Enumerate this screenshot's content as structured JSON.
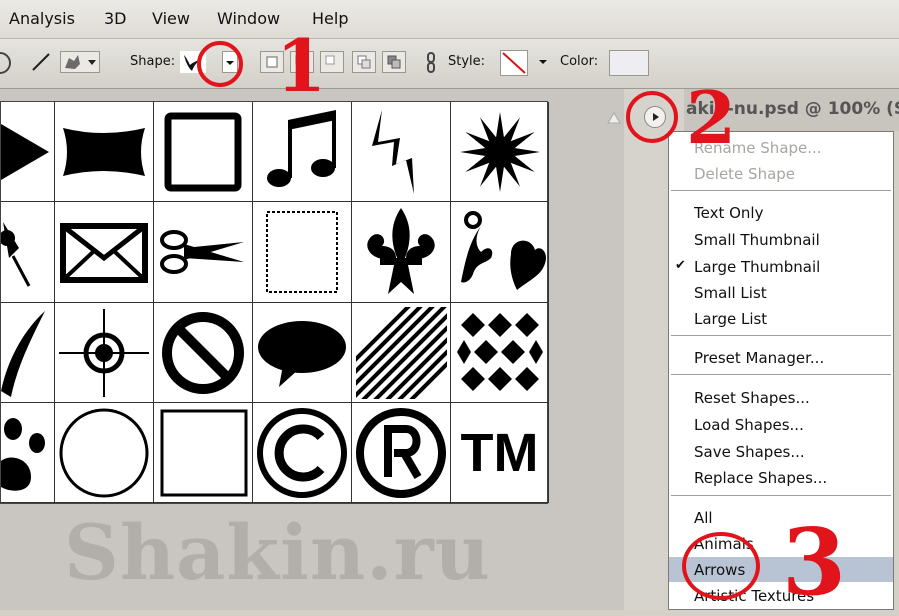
{
  "menubar": {
    "items": [
      "Analysis",
      "3D",
      "View",
      "Window",
      "Help"
    ]
  },
  "options": {
    "shape_label": "Shape:",
    "style_label": "Style:",
    "color_label": "Color:"
  },
  "document": {
    "title": "akin-nu.psd @ 100% (S"
  },
  "shape_icons": [
    "arrow-right-icon",
    "banner-icon",
    "frame-icon",
    "music-note-icon",
    "lightning-icon",
    "starburst-icon",
    "pushpin-icon",
    "envelope-icon",
    "scissors-icon",
    "stamp-frame-icon",
    "fleur-de-lis-icon",
    "ornament-heart-icon",
    "brush-stroke-icon",
    "target-crosshair-icon",
    "no-sign-icon",
    "speech-bubble-icon",
    "hatched-square-icon",
    "checkerboard-icon",
    "paw-print-icon",
    "circle-frame-icon",
    "square-frame-icon",
    "copyright-icon",
    "registered-icon",
    "trademark-icon"
  ],
  "trademark_text": "TM",
  "flyout_menu": {
    "rename": "Rename Shape...",
    "delete": "Delete Shape",
    "text_only": "Text Only",
    "small_thumb": "Small Thumbnail",
    "check_mark": "✔",
    "large_thumb": "Large Thumbnail",
    "small_list": "Small List",
    "large_list": "Large List",
    "preset_manager": "Preset Manager...",
    "reset": "Reset Shapes...",
    "load": "Load Shapes...",
    "save": "Save Shapes...",
    "replace": "Replace Shapes...",
    "all": "All",
    "animals": "Animals",
    "arrows": "Arrows",
    "artistic": "Artistic Textures"
  },
  "callouts": {
    "one": "1",
    "two": "2",
    "three": "3"
  },
  "watermark": "Shakin.ru",
  "colors": {
    "highlight": "#e1141b",
    "menu_highlight": "#b8c3d4"
  }
}
